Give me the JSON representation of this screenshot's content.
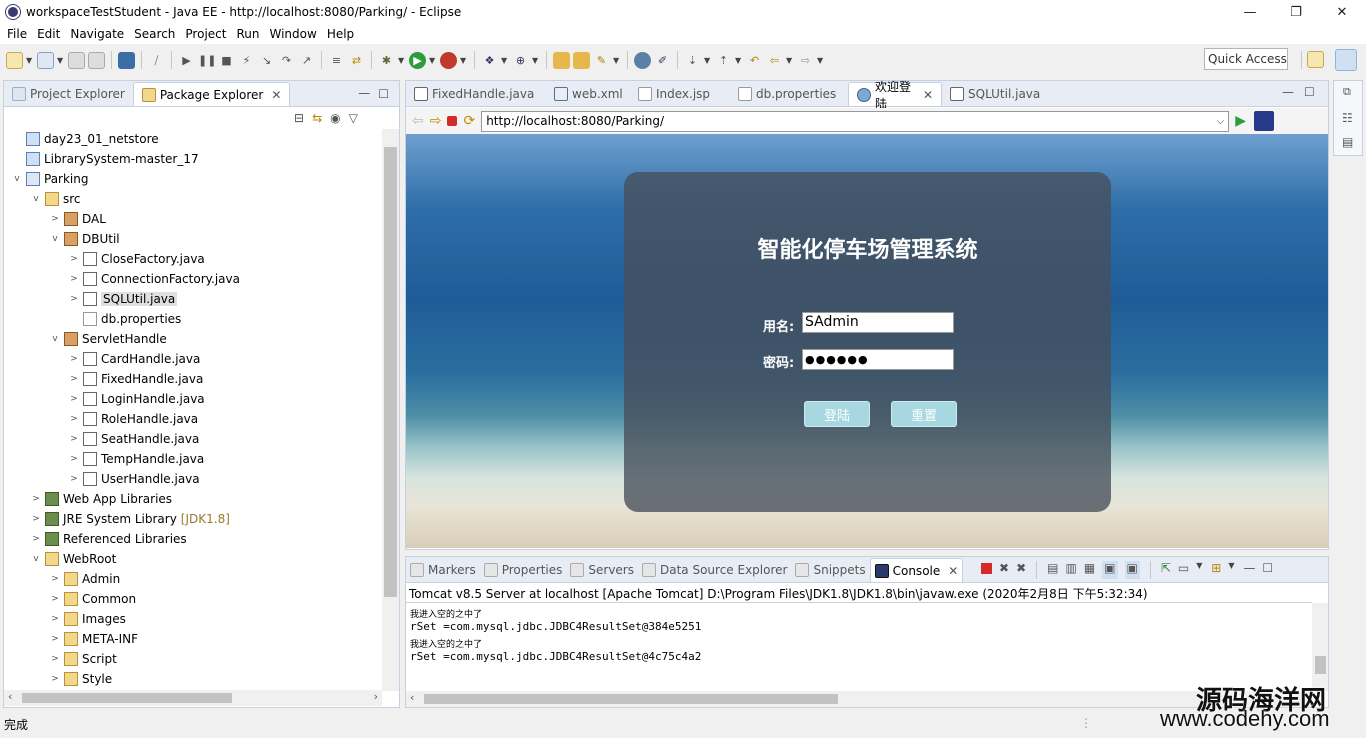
{
  "window": {
    "title": "workspaceTestStudent - Java EE - http://localhost:8080/Parking/ - Eclipse",
    "minimize": "—",
    "restore": "❐",
    "close": "✕"
  },
  "menu": [
    "File",
    "Edit",
    "Navigate",
    "Search",
    "Project",
    "Run",
    "Window",
    "Help"
  ],
  "quick_access": "Quick Access",
  "left_panel": {
    "tabs": [
      "Project Explorer",
      "Package Explorer"
    ],
    "active_tab": "Package Explorer",
    "tree": [
      {
        "label": "day23_01_netstore",
        "indent": 0,
        "twisty": "",
        "icon": "project-icon"
      },
      {
        "label": "LibrarySystem-master_17",
        "indent": 0,
        "twisty": "",
        "icon": "project-icon"
      },
      {
        "label": "Parking",
        "indent": 0,
        "twisty": "v",
        "icon": "web-project-icon"
      },
      {
        "label": "src",
        "indent": 1,
        "twisty": "v",
        "icon": "source-folder-icon"
      },
      {
        "label": "DAL",
        "indent": 2,
        "twisty": ">",
        "icon": "package-icon"
      },
      {
        "label": "DBUtil",
        "indent": 2,
        "twisty": "v",
        "icon": "package-icon"
      },
      {
        "label": "CloseFactory.java",
        "indent": 3,
        "twisty": ">",
        "icon": "java-file-icon"
      },
      {
        "label": "ConnectionFactory.java",
        "indent": 3,
        "twisty": ">",
        "icon": "java-file-icon"
      },
      {
        "label": "SQLUtil.java",
        "indent": 3,
        "twisty": ">",
        "icon": "java-file-icon",
        "selected": true
      },
      {
        "label": "db.properties",
        "indent": 3,
        "twisty": "",
        "icon": "properties-file-icon"
      },
      {
        "label": "ServletHandle",
        "indent": 2,
        "twisty": "v",
        "icon": "package-icon"
      },
      {
        "label": "CardHandle.java",
        "indent": 3,
        "twisty": ">",
        "icon": "java-file-icon"
      },
      {
        "label": "FixedHandle.java",
        "indent": 3,
        "twisty": ">",
        "icon": "java-file-icon"
      },
      {
        "label": "LoginHandle.java",
        "indent": 3,
        "twisty": ">",
        "icon": "java-file-icon"
      },
      {
        "label": "RoleHandle.java",
        "indent": 3,
        "twisty": ">",
        "icon": "java-file-icon"
      },
      {
        "label": "SeatHandle.java",
        "indent": 3,
        "twisty": ">",
        "icon": "java-file-icon"
      },
      {
        "label": "TempHandle.java",
        "indent": 3,
        "twisty": ">",
        "icon": "java-file-icon"
      },
      {
        "label": "UserHandle.java",
        "indent": 3,
        "twisty": ">",
        "icon": "java-file-icon"
      },
      {
        "label": "Web App Libraries",
        "indent": 1,
        "twisty": ">",
        "icon": "library-icon"
      },
      {
        "label": "JRE System Library",
        "suffix": "[JDK1.8]",
        "indent": 1,
        "twisty": ">",
        "icon": "library-icon"
      },
      {
        "label": "Referenced Libraries",
        "indent": 1,
        "twisty": ">",
        "icon": "library-icon"
      },
      {
        "label": "WebRoot",
        "indent": 1,
        "twisty": "v",
        "icon": "folder-icon"
      },
      {
        "label": "Admin",
        "indent": 2,
        "twisty": ">",
        "icon": "folder-icon"
      },
      {
        "label": "Common",
        "indent": 2,
        "twisty": ">",
        "icon": "folder-icon"
      },
      {
        "label": "Images",
        "indent": 2,
        "twisty": ">",
        "icon": "folder-icon"
      },
      {
        "label": "META-INF",
        "indent": 2,
        "twisty": ">",
        "icon": "folder-icon"
      },
      {
        "label": "Script",
        "indent": 2,
        "twisty": ">",
        "icon": "folder-icon"
      },
      {
        "label": "Style",
        "indent": 2,
        "twisty": ">",
        "icon": "folder-icon"
      }
    ]
  },
  "editor": {
    "tabs": [
      {
        "label": "FixedHandle.java",
        "icon": "java-file-icon"
      },
      {
        "label": "web.xml",
        "icon": "xml-file-icon"
      },
      {
        "label": "Index.jsp",
        "icon": "jsp-file-icon"
      },
      {
        "label": "db.properties",
        "icon": "properties-file-icon"
      },
      {
        "label": "欢迎登陆",
        "icon": "browser-icon",
        "active": true
      },
      {
        "label": "SQLUtil.java",
        "icon": "java-file-icon"
      }
    ],
    "url": "http://localhost:8080/Parking/"
  },
  "login": {
    "title": "智能化停车场管理系统",
    "username_label": "用名:",
    "username_value": "SAdmin",
    "password_label": "密码:",
    "password_value": "●●●●●●",
    "login_button": "登陆",
    "reset_button": "重置"
  },
  "bottom_panel": {
    "tabs": [
      "Markers",
      "Properties",
      "Servers",
      "Data Source Explorer",
      "Snippets",
      "Console"
    ],
    "active_tab": "Console",
    "header": "Tomcat v8.5 Server at localhost [Apache Tomcat] D:\\Program Files\\JDK1.8\\JDK1.8\\bin\\javaw.exe (2020年2月8日 下午5:32:34)",
    "lines": [
      "我进入空的之中了",
      "rSet =com.mysql.jdbc.JDBC4ResultSet@384e5251",
      "我进入空的之中了",
      "rSet =com.mysql.jdbc.JDBC4ResultSet@4c75c4a2"
    ]
  },
  "status_bar": {
    "text": "完成"
  },
  "watermark": {
    "line1": "源码海洋网",
    "line2": "www.codehy.com"
  },
  "colors": {
    "accent": "#c5d1e0",
    "selection": "#e0e0e0"
  }
}
